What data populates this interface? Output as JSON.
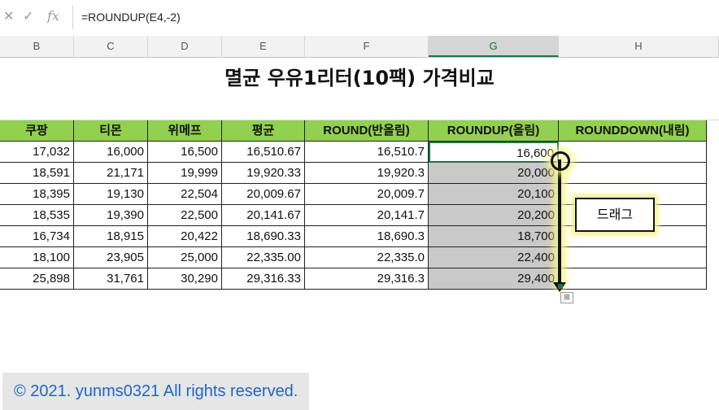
{
  "formula_bar": {
    "cancel_icon": "✕",
    "confirm_icon": "✓",
    "fx_icon": "fx",
    "formula": "=ROUNDUP(E4,-2)"
  },
  "columns": [
    "B",
    "C",
    "D",
    "E",
    "F",
    "G",
    "H"
  ],
  "active_column": "G",
  "title": "멸균 우유1리터(10팩) 가격비교",
  "table": {
    "headers": [
      "쿠팡",
      "티몬",
      "위메프",
      "평균",
      "ROUND(반올림)",
      "ROUNDUP(올림)",
      "ROUNDDOWN(내림)"
    ],
    "rows": [
      [
        "17,032",
        "16,000",
        "16,500",
        "16,510.67",
        "16,510.7",
        "16,600",
        ""
      ],
      [
        "18,591",
        "21,171",
        "19,999",
        "19,920.33",
        "19,920.3",
        "20,000",
        ""
      ],
      [
        "18,395",
        "19,130",
        "22,504",
        "20,009.67",
        "20,009.7",
        "20,100",
        ""
      ],
      [
        "18,535",
        "19,390",
        "22,500",
        "20,141.67",
        "20,141.7",
        "20,200",
        ""
      ],
      [
        "16,734",
        "18,915",
        "20,422",
        "18,690.33",
        "18,690.3",
        "18,700",
        ""
      ],
      [
        "18,100",
        "23,905",
        "25,000",
        "22,335.00",
        "22,335.0",
        "22,400",
        ""
      ],
      [
        "25,898",
        "31,761",
        "30,290",
        "29,316.33",
        "29,316.3",
        "29,400",
        ""
      ]
    ]
  },
  "annotation": {
    "drag_label": "드래그"
  },
  "copyright": "© 2021. yunms0321 All rights reserved.",
  "colors": {
    "header_green": "#92d050",
    "selection_gray": "#c9c9c9",
    "excel_green": "#217346",
    "highlight_yellow": "#f7f58a",
    "copyright_blue": "#1f66c4"
  }
}
